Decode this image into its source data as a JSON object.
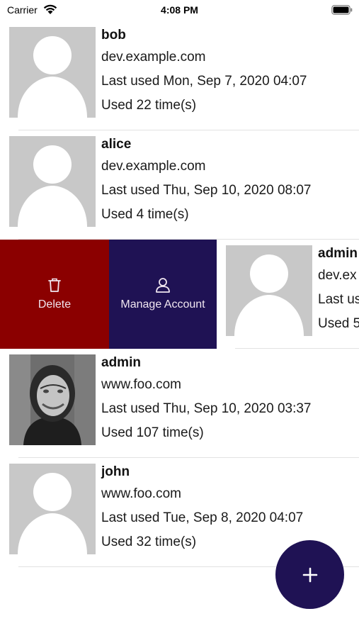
{
  "status_bar": {
    "carrier": "Carrier",
    "time": "4:08 PM"
  },
  "accounts": [
    {
      "name": "bob",
      "server": "dev.example.com",
      "last_used": "Last used Mon, Sep 7, 2020 04:07",
      "used": "Used 22 time(s)",
      "avatar": "placeholder-avatar"
    },
    {
      "name": "alice",
      "server": "dev.example.com",
      "last_used": "Last used Thu, Sep 10, 2020 08:07",
      "used": "Used 4 time(s)",
      "avatar": "placeholder-avatar"
    },
    {
      "name": "admin",
      "server": "dev.ex",
      "last_used": "Last us",
      "used": "Used 5",
      "avatar": "placeholder-avatar"
    },
    {
      "name": "admin",
      "server": "www.foo.com",
      "last_used": "Last used Thu, Sep 10, 2020 03:37",
      "used": "Used 107 time(s)",
      "avatar": "photo-avatar"
    },
    {
      "name": "john",
      "server": "www.foo.com",
      "last_used": "Last used Tue, Sep 8, 2020 04:07",
      "used": "Used 32 time(s)",
      "avatar": "placeholder-avatar"
    }
  ],
  "swipe_actions": {
    "delete_label": "Delete",
    "delete_icon": "trash-icon",
    "manage_label": "Manage Account",
    "manage_icon": "person-icon"
  },
  "fab": {
    "icon": "plus-icon"
  },
  "colors": {
    "delete": "#8b0000",
    "manage": "#1f1254",
    "fab": "#1f1254",
    "avatar_bg": "#c8c8c8"
  }
}
